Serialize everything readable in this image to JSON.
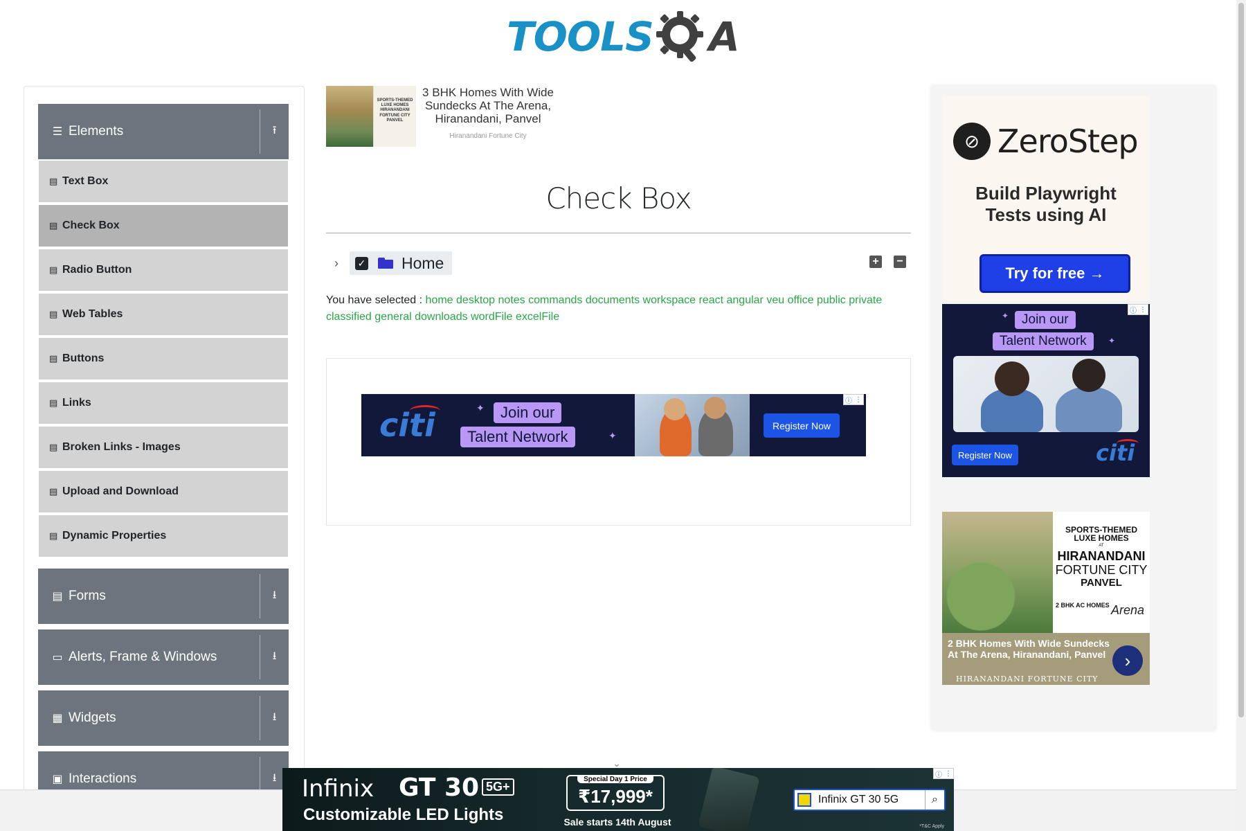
{
  "logo": {
    "text_part1": "TOOLS",
    "text_part3": "A"
  },
  "sidebar": {
    "elements": {
      "label": "Elements",
      "icon": "bars-icon",
      "toggle_icon": "collapse-arrow-icon"
    },
    "items": [
      {
        "label": "Text Box"
      },
      {
        "label": "Check Box",
        "active": true
      },
      {
        "label": "Radio Button"
      },
      {
        "label": "Web Tables"
      },
      {
        "label": "Buttons"
      },
      {
        "label": "Links"
      },
      {
        "label": "Broken Links - Images"
      },
      {
        "label": "Upload and Download"
      },
      {
        "label": "Dynamic Properties"
      }
    ],
    "groups": [
      {
        "label": "Forms",
        "icon": "form-icon"
      },
      {
        "label": "Alerts, Frame & Windows",
        "icon": "window-icon"
      },
      {
        "label": "Widgets",
        "icon": "widgets-icon"
      },
      {
        "label": "Interactions",
        "icon": "interactions-icon"
      }
    ]
  },
  "top_ad": {
    "thumb_text": "SPORTS-THEMED LUXE HOMES HIRANANDANI FORTUNE CITY PANVEL",
    "title": "3 BHK Homes With Wide Sundecks At The Arena, Hiranandani, Panvel",
    "source": "Hiranandani Fortune City"
  },
  "main": {
    "title": "Check Box",
    "tree": {
      "label": "Home",
      "checked": true,
      "expand_all_label": "+",
      "collapse_all_label": "−"
    },
    "result_label": "You have selected :",
    "selected": [
      "home",
      "desktop",
      "notes",
      "commands",
      "documents",
      "workspace",
      "react",
      "angular",
      "veu",
      "office",
      "public",
      "private",
      "classified",
      "general",
      "downloads",
      "wordFile",
      "excelFile"
    ]
  },
  "citi_banner": {
    "logo": "citi",
    "line1": "Join our",
    "line2": "Talent Network",
    "cta": "Register Now"
  },
  "right": {
    "zerostep": {
      "name": "ZeroStep",
      "tagline_1": "Build Playwright",
      "tagline_2": "Tests using AI",
      "cta": "Try for free →"
    },
    "citi": {
      "line1": "Join our",
      "line2": "Talent Network",
      "cta": "Register Now",
      "logo": "citi"
    },
    "hiranandani": {
      "tag1": "SPORTS-THEMED",
      "tag2": "LUXE HOMES",
      "at": "AT",
      "brand": "HIRANANDANI",
      "fortune": "FORTUNE CITY",
      "panvel": "PANVEL",
      "badge": "2 BHK AC HOMES",
      "arena": "Arena",
      "title": "2 BHK Homes With Wide Sundecks At The Arena, Hiranandani, Panvel",
      "source": "HIRANANDANI FORTUNE CITY"
    }
  },
  "bottom_ad": {
    "brand": "Infinix",
    "model": "GT 30",
    "model_badge": "5G+",
    "subtitle": "Customizable LED Lights",
    "price_label": "Special Day 1 Price",
    "price": "₹17,999*",
    "sale": "Sale starts 14th August",
    "search_text": "Infinix GT 30 5G",
    "tc": "*T&C Apply"
  },
  "colors": {
    "sidebar_group": "#6c757d",
    "sidebar_item": "#d3d3d3",
    "sidebar_item_active": "#b3b3b3",
    "selected_text": "#28a745",
    "logo_blue": "#1990c6"
  }
}
